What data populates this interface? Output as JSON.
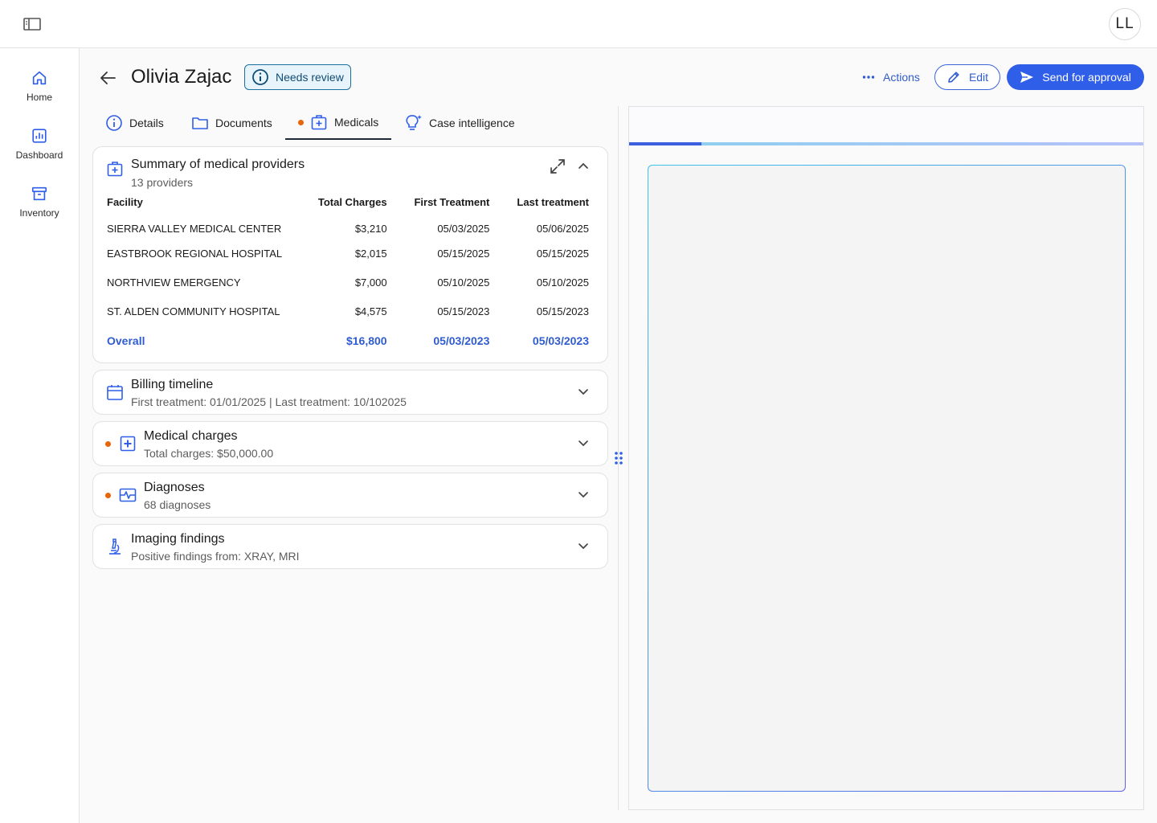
{
  "topbar": {
    "avatar_initials": "LL",
    "sidebar_toggle_icon": "sidebar-panel-icon"
  },
  "nav": {
    "items": [
      {
        "label": "Home",
        "icon": "home-icon"
      },
      {
        "label": "Dashboard",
        "icon": "chart-icon"
      },
      {
        "label": "Inventory",
        "icon": "archive-icon"
      }
    ]
  },
  "header": {
    "title": "Olivia Zajac",
    "status": "Needs review",
    "actions_label": "Actions",
    "edit_label": "Edit",
    "send_label": "Send for approval"
  },
  "tabs": [
    {
      "label": "Details",
      "icon": "info-icon"
    },
    {
      "label": "Documents",
      "icon": "folder-icon"
    },
    {
      "label": "Medicals",
      "icon": "medical-case-icon",
      "active": true,
      "has_dot": true
    },
    {
      "label": "Case intelligence",
      "icon": "lightbulb-sparkle-icon"
    }
  ],
  "providers": {
    "title": "Summary of medical providers",
    "subtitle": "13 providers",
    "columns": [
      "Facility",
      "Total Charges",
      "First Treatment",
      "Last treatment"
    ],
    "rows": [
      {
        "facility": "SIERRA VALLEY MEDICAL CENTER",
        "charges": "$3,210",
        "first": "05/03/2025",
        "last": "05/06/2025"
      },
      {
        "facility": "EASTBROOK REGIONAL HOSPITAL",
        "charges": "$2,015",
        "first": "05/15/2025",
        "last": "05/15/2025"
      },
      {
        "facility": "NORTHVIEW EMERGENCY",
        "charges": "$7,000",
        "first": "05/10/2025",
        "last": "05/10/2025"
      },
      {
        "facility": "ST. ALDEN COMMUNITY HOSPITAL",
        "charges": "$4,575",
        "first": "05/15/2023",
        "last": "05/15/2023"
      }
    ],
    "overall": {
      "label": "Overall",
      "charges": "$16,800",
      "first": "05/03/2023",
      "last": "05/03/2023"
    }
  },
  "sections": [
    {
      "title": "Billing timeline",
      "subtitle": "First treatment: 01/01/2025 | Last treatment: 10/102025",
      "icon": "calendar-icon",
      "has_dot": false
    },
    {
      "title": "Medical charges",
      "subtitle": "Total charges: $50,000.00",
      "icon": "medical-plus-icon",
      "has_dot": true
    },
    {
      "title": "Diagnoses",
      "subtitle": "68 diagnoses",
      "icon": "vitals-icon",
      "has_dot": true
    },
    {
      "title": "Imaging findings",
      "subtitle": "Positive findings from: XRAY, MRI",
      "icon": "microscope-icon",
      "has_dot": false
    }
  ],
  "viewer": {
    "progress_fraction": 0.14
  },
  "colors": {
    "accent": "#2f5ee8",
    "alert_dot": "#e8640c",
    "badge_border": "#1d6fa0"
  }
}
